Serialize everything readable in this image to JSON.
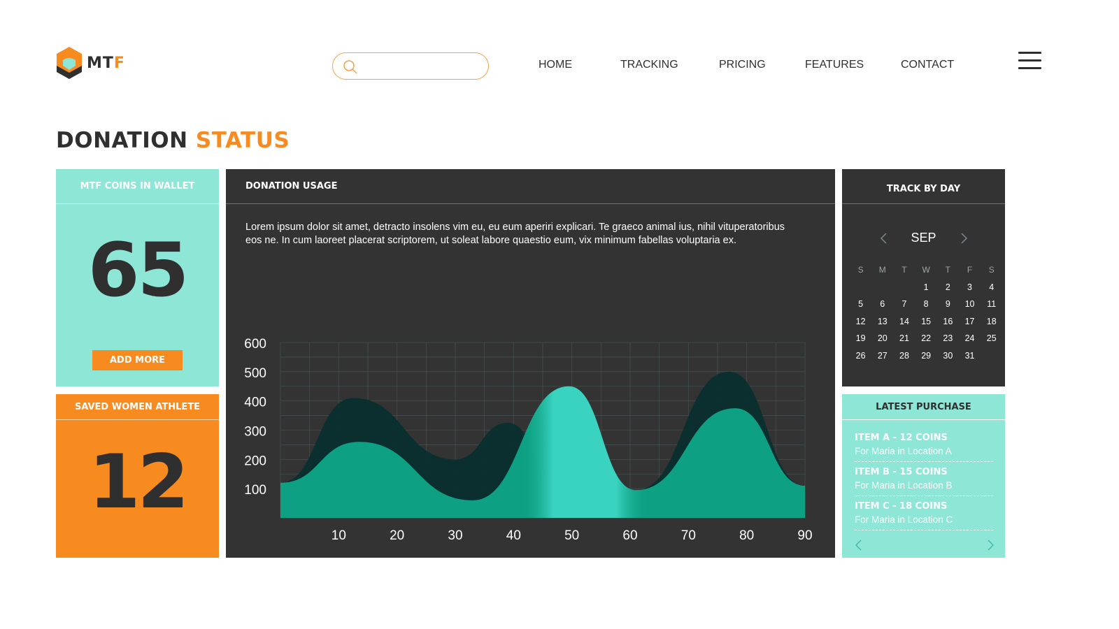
{
  "header": {
    "logo_text_main": "MT",
    "logo_text_accent": "F",
    "search": {
      "placeholder": "",
      "value": ""
    },
    "nav": [
      "HOME",
      "TRACKING",
      "PRICING",
      "FEATURES",
      "CONTACT"
    ],
    "menu_icon": "hamburger-icon"
  },
  "page_title": {
    "main": "DONATION",
    "accent": "STATUS"
  },
  "coins_card": {
    "title": "MTF COINS IN WALLET",
    "value": "65",
    "button_label": "ADD MORE"
  },
  "athlete_card": {
    "title": "SAVED WOMEN ATHLETE",
    "value": "12"
  },
  "usage": {
    "title": "DONATION USAGE",
    "description": "Lorem ipsum dolor sit amet, detracto insolens vim eu, eu eum aperiri explicari. Te graeco animal ius, nihil vituperatoribus eos ne. In cum laoreet placerat scriptorem, ut soleat labore quaestio eum, vix minimum fabellas voluptaria ex."
  },
  "chart_data": {
    "type": "area",
    "title": "",
    "xlabel": "",
    "ylabel": "",
    "x_ticks": [
      10,
      20,
      30,
      40,
      50,
      60,
      70,
      80,
      90
    ],
    "y_ticks": [
      100,
      200,
      300,
      400,
      500,
      600
    ],
    "xlim": [
      0,
      90
    ],
    "ylim": [
      0,
      600
    ],
    "grid": true,
    "series": [
      {
        "x": [
          0,
          12.5,
          30,
          39,
          50,
          61,
          77,
          90
        ],
        "values": [
          120,
          410,
          200,
          325,
          10,
          95,
          500,
          110
        ],
        "color": "#082f2e"
      },
      {
        "x": [
          0,
          13.5,
          33,
          49.5,
          61,
          78,
          90
        ],
        "values": [
          120,
          260,
          60,
          450,
          95,
          375,
          110
        ],
        "color": "#0ea688"
      }
    ],
    "highlight_color": "#3ad3c0"
  },
  "calendar": {
    "title": "TRACK BY DAY",
    "month": "SEP",
    "days_of_week": [
      "S",
      "M",
      "T",
      "W",
      "T",
      "F",
      "S"
    ],
    "first_weekday": 3,
    "days": [
      "1",
      "2",
      "3",
      "4",
      "5",
      "6",
      "7",
      "8",
      "9",
      "10",
      "11",
      "12",
      "13",
      "14",
      "15",
      "16",
      "17",
      "18",
      "19",
      "20",
      "21",
      "22",
      "23",
      "24",
      "25",
      "26",
      "27",
      "28",
      "29",
      "30",
      "31"
    ]
  },
  "purchase": {
    "title": "LATEST PURCHASE",
    "items": [
      {
        "title": "ITEM A - 12 COINS",
        "subtitle": "For Maria in Location A"
      },
      {
        "title": "ITEM B - 15 COINS",
        "subtitle": "For Maria in Location B"
      },
      {
        "title": "ITEM C - 18 COINS",
        "subtitle": "For Maria in Location C"
      }
    ]
  },
  "colors": {
    "accent_orange": "#f78b1f",
    "mint": "#8ee6d6",
    "panel_dark": "#333333",
    "text_dark": "#2f2f2f"
  }
}
